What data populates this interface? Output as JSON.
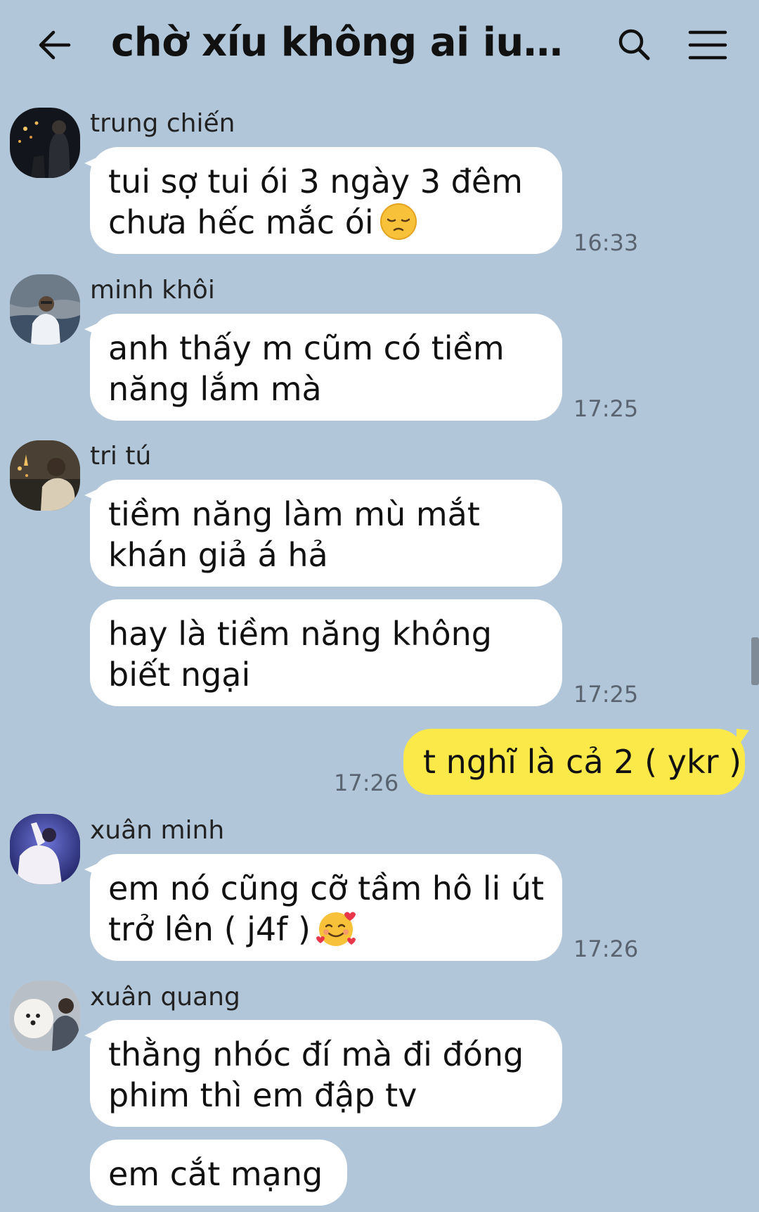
{
  "header": {
    "title": "chờ xíu không ai iu em...",
    "back_icon": "arrow-left-icon",
    "search_icon": "search-icon",
    "menu_icon": "hamburger-menu-icon"
  },
  "colors": {
    "background": "#b1c6d9",
    "incoming_bubble": "#ffffff",
    "outgoing_bubble": "#fbe94a",
    "timestamp": "#5a6470"
  },
  "messages": [
    {
      "sender": "trung chiến",
      "lines": [
        "tui sợ tui ói 3 ngày 3 đêm",
        "chưa hếc mắc ói"
      ],
      "emoji": "pensive-face-emoji",
      "time": "16:33"
    },
    {
      "sender": "minh khôi",
      "lines": [
        "anh thấy m cũm có tiềm",
        "năng lắm mà"
      ],
      "time": "17:25"
    },
    {
      "sender": "tri tú",
      "lines": [
        "tiềm năng làm mù mắt",
        "khán giả á hả"
      ]
    },
    {
      "lines": [
        "hay là tiềm năng không",
        "biết ngại"
      ],
      "time": "17:25"
    },
    {
      "outgoing": true,
      "lines": [
        "t nghĩ là cả 2 ( ykr )"
      ],
      "time": "17:26"
    },
    {
      "sender": "xuân minh",
      "lines": [
        "em nó cũng cỡ tầm hô li út",
        "trở lên ( j4f )"
      ],
      "emoji": "smiling-face-with-hearts-emoji",
      "time": "17:26"
    },
    {
      "sender": "xuân quang",
      "lines": [
        "thằng nhóc đí mà đi đóng",
        "phim thì em đập tv"
      ]
    },
    {
      "lines": [
        "em cắt mạng"
      ]
    }
  ]
}
